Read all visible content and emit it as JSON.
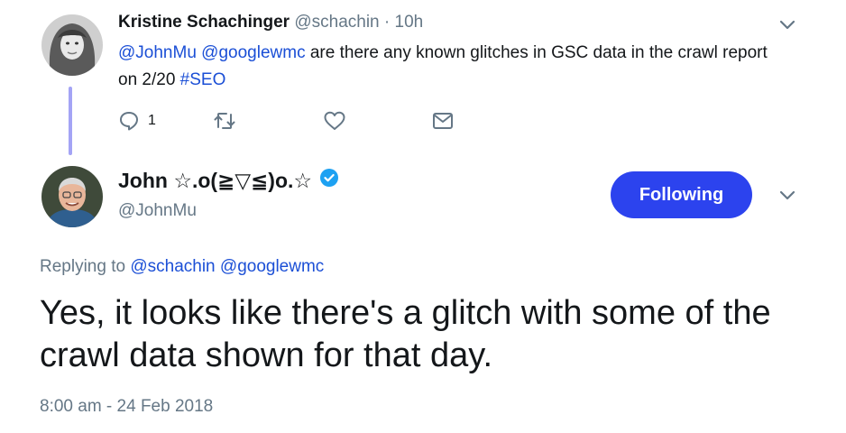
{
  "reply_tweet": {
    "display_name": "Kristine Schachinger",
    "handle": "@schachin",
    "separator": "·",
    "time": "10h",
    "text_parts": {
      "mention1": "@JohnMu",
      "mention2": "@googlewmc",
      "body": " are there any known glitches in GSC data in the crawl report on 2/20 ",
      "hashtag": "#SEO"
    },
    "reply_count": "1",
    "icons": [
      "reply-icon",
      "retweet-icon",
      "like-icon",
      "message-icon",
      "chevron-down-icon"
    ]
  },
  "main_tweet": {
    "display_name": "John ☆.o(≧▽≦)o.☆",
    "handle": "@JohnMu",
    "verified": true,
    "follow_label": "Following",
    "replying_prefix": "Replying to",
    "replying_to": [
      "@schachin",
      "@googlewmc"
    ],
    "text": "Yes, it looks like there's a glitch with some of the crawl data shown for that day.",
    "timestamp": "8:00 am - 24 Feb 2018"
  },
  "colors": {
    "link": "#1b4fd6",
    "button": "#2c43ee",
    "thread_line": "#a4a4f5",
    "secondary_text": "#657786",
    "verified": "#1da1f2"
  }
}
